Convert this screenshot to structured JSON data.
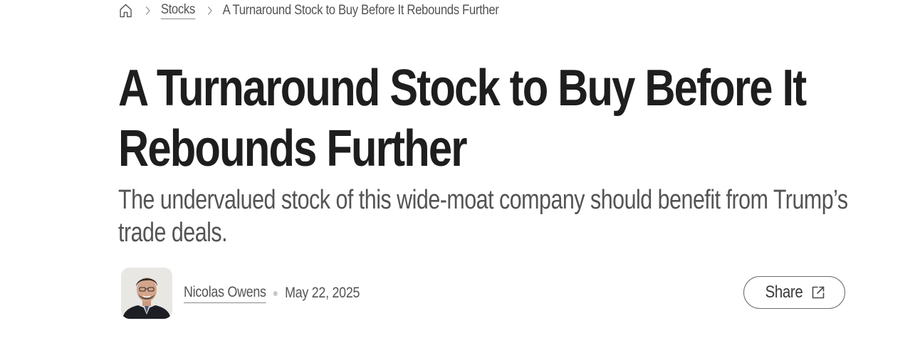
{
  "breadcrumb": {
    "home_icon": "home-icon",
    "section": "Stocks",
    "current": "A Turnaround Stock to Buy Before It Rebounds Further"
  },
  "article": {
    "headline": "A Turnaround Stock to Buy Before It Rebounds Further",
    "subheadline": "The undervalued stock of this wide-moat company should benefit from Trump’s trade deals.",
    "author": "Nicolas Owens",
    "date": "May 22, 2025"
  },
  "share": {
    "label": "Share",
    "icon": "external-link-icon"
  },
  "colors": {
    "headline": "#1e1e1e",
    "body_text": "#545454",
    "separator_dot": "#c8c8c8",
    "button_border": "#6a6a6a"
  }
}
